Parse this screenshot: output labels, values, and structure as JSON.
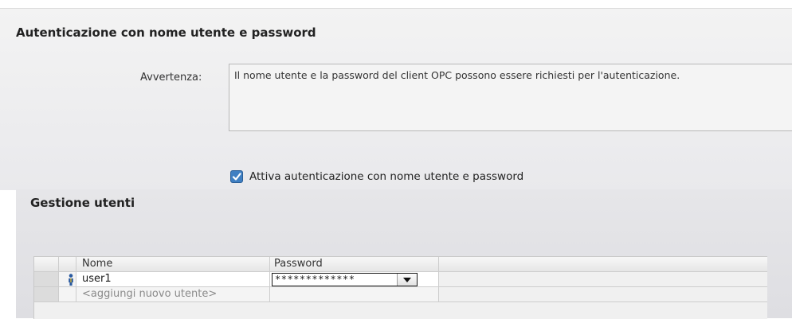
{
  "auth": {
    "title": "Autenticazione con nome utente e password",
    "warning_label": "Avvertenza:",
    "warning_text": "Il nome utente e la password del client OPC possono essere richiesti per l'autenticazione.",
    "enable_checked": true,
    "enable_label": "Attiva autenticazione con nome utente e password"
  },
  "users": {
    "title": "Gestione utenti",
    "columns": [
      "Nome",
      "Password"
    ],
    "rows": [
      {
        "icon": "user-icon",
        "name": "user1",
        "password": "*************"
      }
    ],
    "add_placeholder": "<aggiungi nuovo utente>"
  },
  "colors": {
    "checkbox": "#3f7fc2",
    "panel_bg": "#ededf0"
  }
}
